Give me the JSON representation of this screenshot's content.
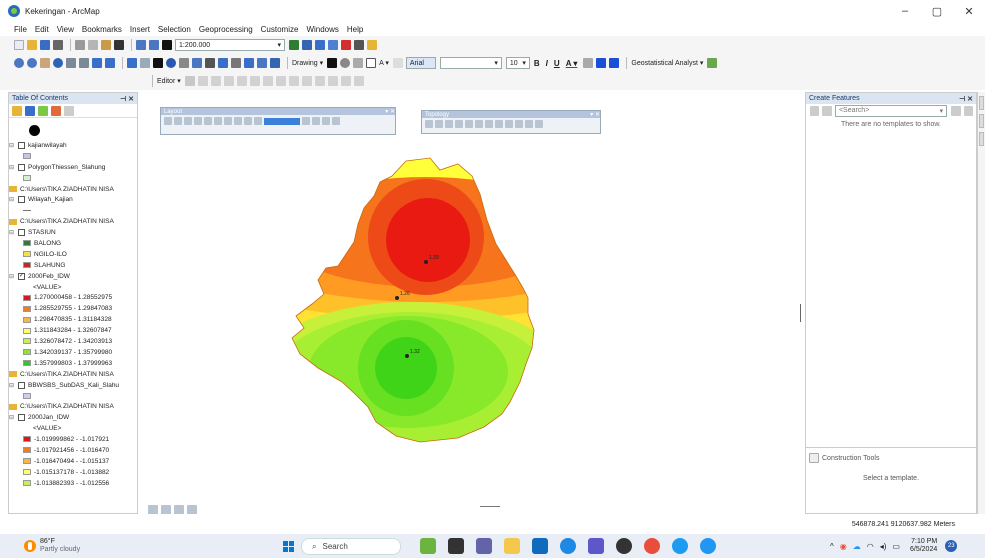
{
  "window": {
    "title": "Kekeringan - ArcMap",
    "controls": [
      "–",
      "▢",
      "✕"
    ]
  },
  "menu": [
    "File",
    "Edit",
    "View",
    "Bookmarks",
    "Insert",
    "Selection",
    "Geoprocessing",
    "Customize",
    "Windows",
    "Help"
  ],
  "toolbar": {
    "scale": "1:200.000",
    "drawing_label": "Drawing ▾",
    "font_name": "Arial",
    "font_size": "10",
    "bold": "B",
    "italic": "I",
    "underline": "U",
    "geostat_label": "Geostatistical Analyst ▾",
    "editor_label": "Editor ▾"
  },
  "toc": {
    "title": "Table Of Contents",
    "items": [
      {
        "type": "dot"
      },
      {
        "type": "layer",
        "label": "kajianwilayah",
        "checked": false
      },
      {
        "type": "swatch",
        "color": "#c9c3e8",
        "label": ""
      },
      {
        "type": "layer",
        "label": "PolygonThiessen_Slahung",
        "checked": false
      },
      {
        "type": "swatch",
        "color": "#d6efd0",
        "label": ""
      },
      {
        "type": "folder",
        "label": "C:\\Users\\TIKA ZIADHATIN NISA"
      },
      {
        "type": "layer",
        "label": "Wilayah_Kajian",
        "checked": false
      },
      {
        "type": "line",
        "label": ""
      },
      {
        "type": "folder",
        "label": "C:\\Users\\TIKA ZIADHATIN NISA"
      },
      {
        "type": "layer",
        "label": "STASIUN",
        "checked": false
      },
      {
        "type": "swatch",
        "color": "#2e7d32",
        "label": "BALONG"
      },
      {
        "type": "swatch",
        "color": "#f4e242",
        "label": "NGILO-ILO"
      },
      {
        "type": "swatch",
        "color": "#c62828",
        "label": "SLAHUNG"
      },
      {
        "type": "layer",
        "label": "2000Feb_IDW",
        "checked": true
      },
      {
        "type": "text",
        "label": "<VALUE>"
      },
      {
        "type": "swatch",
        "color": "#d7191c",
        "label": "1.270000458 - 1.28552975"
      },
      {
        "type": "swatch",
        "color": "#f07c2a",
        "label": "1.285529755 - 1.29847083"
      },
      {
        "type": "swatch",
        "color": "#f7b64a",
        "label": "1.298470835 - 1.31184328"
      },
      {
        "type": "swatch",
        "color": "#ffff6e",
        "label": "1.311843284 - 1.32607847"
      },
      {
        "type": "swatch",
        "color": "#c8ef55",
        "label": "1.326078472 - 1.34203913"
      },
      {
        "type": "swatch",
        "color": "#8fe23b",
        "label": "1.342039137 - 1.35799980"
      },
      {
        "type": "swatch",
        "color": "#38c22f",
        "label": "1.357999803 - 1.37999963"
      },
      {
        "type": "folder",
        "label": "C:\\Users\\TIKA ZIADHATIN NISA"
      },
      {
        "type": "layer",
        "label": "BBWSBS_SubDAS_Kali_Slahu",
        "checked": false
      },
      {
        "type": "swatch",
        "color": "#d4c9ef",
        "label": ""
      },
      {
        "type": "folder",
        "label": "C:\\Users\\TIKA ZIADHATIN NISA"
      },
      {
        "type": "layer",
        "label": "2000Jan_IDW",
        "checked": false
      },
      {
        "type": "text",
        "label": "<VALUE>"
      },
      {
        "type": "swatch",
        "color": "#d7191c",
        "label": "-1.019999862 - -1.017921"
      },
      {
        "type": "swatch",
        "color": "#f07c2a",
        "label": "-1.017921456 - -1.016470"
      },
      {
        "type": "swatch",
        "color": "#f7b64a",
        "label": "-1.016470494 - -1.015137"
      },
      {
        "type": "swatch",
        "color": "#ffff6e",
        "label": "-1.015137178 - -1.013882"
      },
      {
        "type": "swatch",
        "color": "#c8ef55",
        "label": "-1.013882393 - -1.012556"
      }
    ]
  },
  "map": {
    "labels": {
      "top": "1.39",
      "mid": "1.26",
      "bottom": "1.32"
    },
    "layout_toolbar_title": "Layout",
    "topology_toolbar_title": "Topology",
    "zones": [
      "#ffff3a",
      "#ffe232",
      "#ffc12a",
      "#ff9a22",
      "#f5741c",
      "#ee4a17",
      "#e91a12",
      "#c6f03a",
      "#a8ee32",
      "#88e82a",
      "#66e020",
      "#40d418"
    ]
  },
  "create_features": {
    "title": "Create Features",
    "search_placeholder": "<Search>",
    "empty_message": "There are no templates to show.",
    "construction_title": "Construction Tools",
    "construction_message": "Select a template."
  },
  "status": {
    "coords": "546878.241 9120637.982 Meters"
  },
  "taskbar": {
    "temperature": "86°F",
    "weather": "Partly cloudy",
    "search": "Search",
    "time": "7:10 PM",
    "date": "6/5/2024",
    "notifications": "23"
  }
}
